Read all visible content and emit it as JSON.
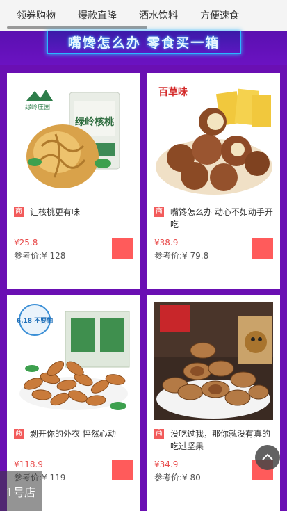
{
  "tabs": [
    {
      "label": "领券购物"
    },
    {
      "label": "爆款直降"
    },
    {
      "label": "酒水饮料"
    },
    {
      "label": "方便速食"
    }
  ],
  "banner": {
    "text": "嘴馋怎么办 零食买一箱"
  },
  "products": [
    {
      "title": "让核桃更有味",
      "price": "¥25.8",
      "ref": "参考价:¥ 128",
      "brand": "绿岭庄园",
      "package_text": "绿岭核桃"
    },
    {
      "title": "嘴馋怎么办 动心不如动手开吃",
      "price": "¥38.9",
      "ref": "参考价:¥ 79.8",
      "brand": "百草味"
    },
    {
      "title": "剥开你的外衣 怦然心动",
      "price": "¥118.9",
      "ref": "参考价:¥ 119",
      "badge": "6.18 不要怕"
    },
    {
      "title": "没吃过我，那你就没有真的吃过坚果",
      "price": "¥34.9",
      "ref": "参考价:¥ 80"
    }
  ],
  "shop_badge": "商",
  "corner_text": "1号店",
  "colors": {
    "background": "#6a0fb3",
    "price": "#e84a4a",
    "cart": "#ff5b5b",
    "badge": "#f25b5b"
  },
  "icons": {
    "back_to_top": "chevron-up-icon",
    "cart": "cart-square-icon"
  }
}
